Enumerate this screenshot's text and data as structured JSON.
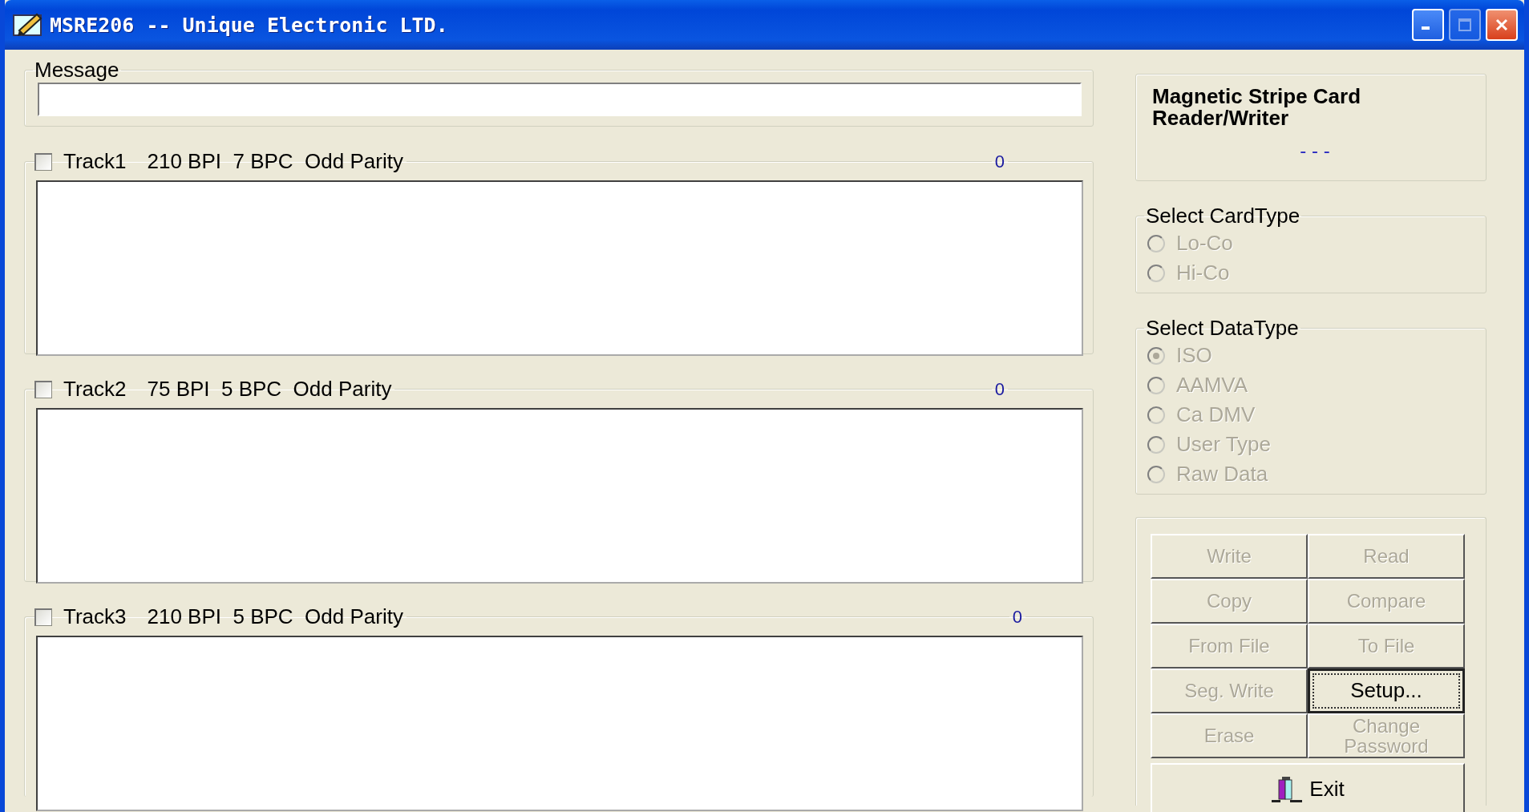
{
  "window": {
    "title": "MSRE206 -- Unique Electronic LTD."
  },
  "message": {
    "label": "Message"
  },
  "tracks": [
    {
      "label": "Track1",
      "spec": "210 BPI  7 BPC  Odd Parity",
      "count": "0",
      "checked": false
    },
    {
      "label": "Track2",
      "spec": "75 BPI  5 BPC  Odd Parity",
      "count": "0",
      "checked": false
    },
    {
      "label": "Track3",
      "spec": "210 BPI  5 BPC  Odd Parity",
      "count": "0",
      "checked": false
    }
  ],
  "header": {
    "title": "Magnetic Stripe Card Reader/Writer",
    "status": "- - -"
  },
  "card_type": {
    "label": "Select CardType",
    "options": [
      {
        "label": "Lo-Co",
        "selected": false,
        "disabled": true
      },
      {
        "label": "Hi-Co",
        "selected": false,
        "disabled": true
      }
    ]
  },
  "data_type": {
    "label": "Select DataType",
    "options": [
      {
        "label": "ISO",
        "selected": true,
        "disabled": true
      },
      {
        "label": "AAMVA",
        "selected": false,
        "disabled": true
      },
      {
        "label": "Ca DMV",
        "selected": false,
        "disabled": true
      },
      {
        "label": "User Type",
        "selected": false,
        "disabled": true
      },
      {
        "label": "Raw Data",
        "selected": false,
        "disabled": true
      }
    ]
  },
  "buttons": [
    {
      "label": "Write",
      "disabled": true,
      "focused": false
    },
    {
      "label": "Read",
      "disabled": true,
      "focused": false
    },
    {
      "label": "Copy",
      "disabled": true,
      "focused": false
    },
    {
      "label": "Compare",
      "disabled": true,
      "focused": false
    },
    {
      "label": "From File",
      "disabled": true,
      "focused": false
    },
    {
      "label": "To File",
      "disabled": true,
      "focused": false
    },
    {
      "label": "Seg. Write",
      "disabled": true,
      "focused": false
    },
    {
      "label": "Setup...",
      "disabled": false,
      "focused": true
    },
    {
      "label": "Erase",
      "disabled": true,
      "focused": false
    },
    {
      "label": "Change Password",
      "disabled": true,
      "focused": false
    }
  ],
  "exit_button": {
    "label": "Exit",
    "disabled": false
  }
}
